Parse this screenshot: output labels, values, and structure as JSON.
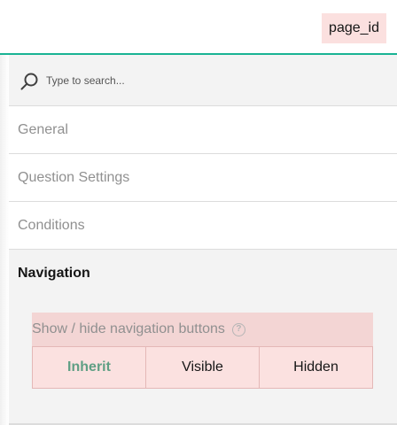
{
  "header": {
    "page_id_label": "page_id"
  },
  "search": {
    "placeholder": "Type to search..."
  },
  "categories": [
    {
      "label": "General"
    },
    {
      "label": "Question Settings"
    },
    {
      "label": "Conditions"
    },
    {
      "label": "Navigation",
      "expanded": true
    }
  ],
  "navigation": {
    "property_title": "Show / hide navigation buttons",
    "help_icon_glyph": "?",
    "options": [
      "Inherit",
      "Visible",
      "Hidden"
    ],
    "selected": "Inherit"
  },
  "colors": {
    "accent": "#19b394",
    "selected_option": "#5f9f84",
    "highlight": "#fbe0df"
  }
}
